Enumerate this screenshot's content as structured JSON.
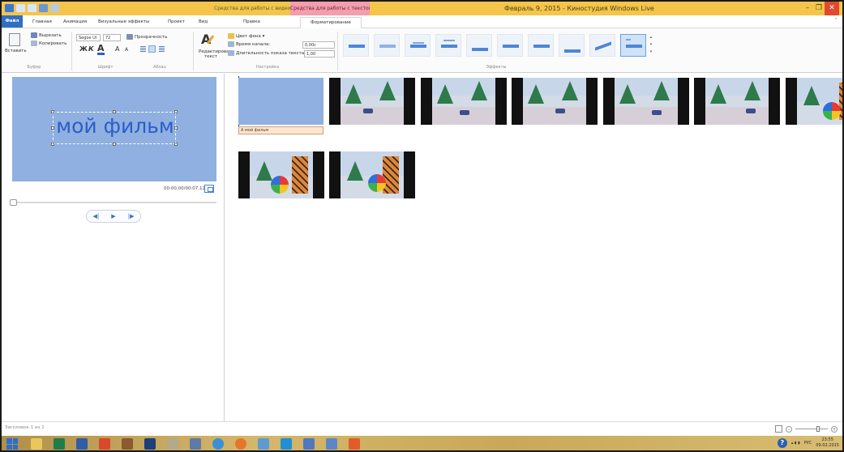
{
  "titlebar": {
    "context_video": "Средства для работы с видео",
    "context_text": "Средства для работы с текстом",
    "title": "Февраль 9, 2015 - Киностудия Windows Live"
  },
  "tabs": [
    "Файл",
    "Главная",
    "Анимация",
    "Визуальные эффекты",
    "Проект",
    "Вид",
    "Правка",
    "Форматирование"
  ],
  "ribbon": {
    "clipboard": {
      "paste": "Вставить",
      "cut": "Вырезать",
      "copy": "Копировать",
      "label": "Буфер"
    },
    "font": {
      "family": "Segoe UI",
      "size": "72",
      "transparency": "Прозрачность",
      "bold": "Ж",
      "italic": "К",
      "label": "Шрифт"
    },
    "paragraph": {
      "label": "Абзац"
    },
    "adjust": {
      "edit_text": "Редактировать текст",
      "bg_color": "Цвет фона",
      "start_time": "Время начала:",
      "start_time_value": "0,00с",
      "duration": "Длительность показа текста:",
      "duration_value": "1,00",
      "label": "Настройка"
    },
    "effects": {
      "label": "Эффекты"
    }
  },
  "preview": {
    "overlay_text": "мой фильм",
    "timecode": "00:00,00/00:07,12"
  },
  "storyboard": {
    "title_clip_label": "A мой фильм"
  },
  "status": {
    "text": "Заголовок 1 из 1"
  },
  "taskbar": {
    "lang": "РУС",
    "time": "23:55",
    "date": "09.02.2015"
  },
  "colors": {
    "accent": "#2f6fc6",
    "titlebar": "#f4c54a",
    "context_text": "#f39dae",
    "stage": "#8fb0e0",
    "overlay_text": "#2b5ec9"
  }
}
